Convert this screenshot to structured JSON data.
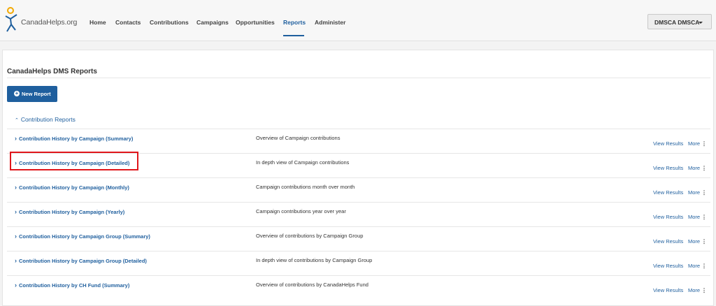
{
  "app": {
    "logo_text": "CanadaHelps.org"
  },
  "nav": {
    "items": [
      {
        "label": "Home"
      },
      {
        "label": "Contacts"
      },
      {
        "label": "Contributions"
      },
      {
        "label": "Campaigns"
      },
      {
        "label": "Opportunities"
      },
      {
        "label": "Reports",
        "active": true
      },
      {
        "label": "Administer"
      }
    ]
  },
  "user_menu": {
    "label": "DMSCA DMSCA"
  },
  "page": {
    "title": "CanadaHelps DMS Reports",
    "new_report_label": "New Report",
    "new_report_icon": "plus-circle-icon"
  },
  "section": {
    "label": "Contribution Reports",
    "chevron_icon": "chevron-up-icon"
  },
  "reports": [
    {
      "name": "Contribution History by Campaign (Summary)",
      "description": "Overview of Campaign contributions",
      "view": "View Results",
      "more": "More"
    },
    {
      "name": "Contribution History by Campaign (Detailed)",
      "description": "In depth view of Campaign contributions",
      "view": "View Results",
      "more": "More"
    },
    {
      "name": "Contribution History by Campaign (Monthly)",
      "description": "Campaign contributions month over month",
      "view": "View Results",
      "more": "More"
    },
    {
      "name": "Contribution History by Campaign (Yearly)",
      "description": "Campaign contributions year over year",
      "view": "View Results",
      "more": "More"
    },
    {
      "name": "Contribution History by Campaign Group (Summary)",
      "description": "Overview of contributions by Campaign Group",
      "view": "View Results",
      "more": "More"
    },
    {
      "name": "Contribution History by Campaign Group (Detailed)",
      "description": "In depth view of contributions by Campaign Group",
      "view": "View Results",
      "more": "More"
    },
    {
      "name": "Contribution History by CH Fund (Summary)",
      "description": "Overview of contributions by CanadaHelps Fund",
      "view": "View Results",
      "more": "More"
    }
  ],
  "colors": {
    "accent": "#1f5f9e",
    "highlight": "#e0161b"
  }
}
